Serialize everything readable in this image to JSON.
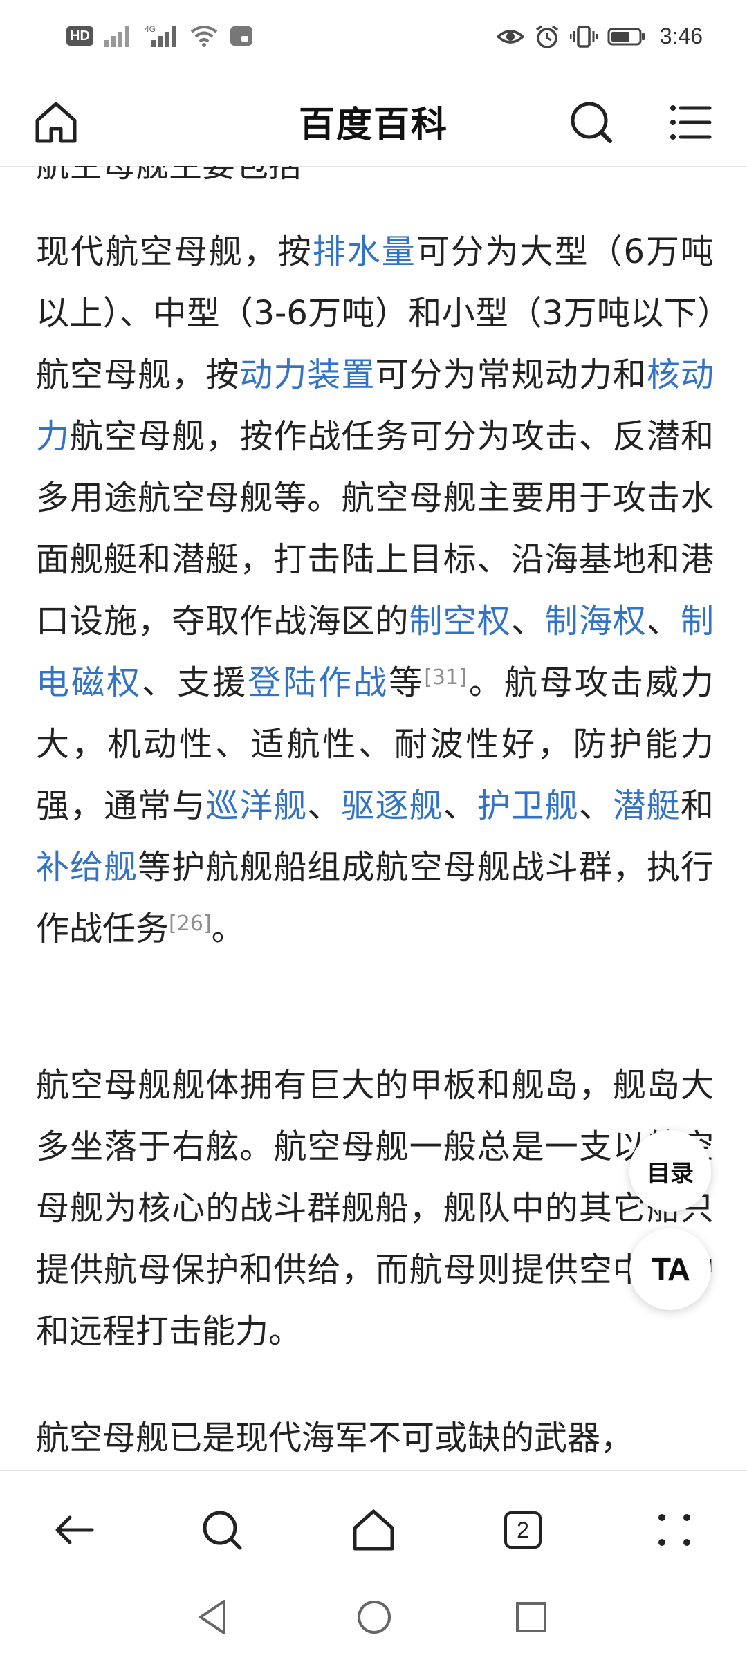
{
  "status_bar": {
    "hd_badge": "HD",
    "sim_label": "2",
    "net_label": "4G",
    "time": "3:46"
  },
  "header": {
    "title": "百度百科"
  },
  "content": {
    "partial_line": "航空母舰主要包括",
    "paragraphs": [
      {
        "segments": [
          {
            "text": "现代航空母舰，按",
            "link": false
          },
          {
            "text": "排水量",
            "link": true
          },
          {
            "text": "可分为大型（6万吨以上）、中型（3-6万吨）和小型（3万吨以下）航空母舰，按",
            "link": false
          },
          {
            "text": "动力装置",
            "link": true
          },
          {
            "text": "可分为常规动力和",
            "link": false
          },
          {
            "text": "核动力",
            "link": true
          },
          {
            "text": "航空母舰，按作战任务可分为攻击、反潜和多用途航空母舰等。航空母舰主要用于攻击水面舰艇和潜艇，打击陆上目标、沿海基地和港口设施，夺取作战海区的",
            "link": false
          },
          {
            "text": "制空权",
            "link": true
          },
          {
            "text": "、",
            "link": false
          },
          {
            "text": "制海权",
            "link": true
          },
          {
            "text": "、",
            "link": false
          },
          {
            "text": "制电磁权",
            "link": true
          },
          {
            "text": "、支援",
            "link": false
          },
          {
            "text": "登陆作战",
            "link": true
          },
          {
            "text": "等",
            "link": false
          },
          {
            "text": "[31]",
            "ref": true
          },
          {
            "text": "。航母攻击威力大，机动性、适航性、耐波性好，防护能力强，通常与",
            "link": false
          },
          {
            "text": "巡洋舰",
            "link": true
          },
          {
            "text": "、",
            "link": false
          },
          {
            "text": "驱逐舰",
            "link": true
          },
          {
            "text": "、",
            "link": false
          },
          {
            "text": "护卫舰",
            "link": true
          },
          {
            "text": "、",
            "link": false
          },
          {
            "text": "潜艇",
            "link": true
          },
          {
            "text": "和",
            "link": false
          },
          {
            "text": "补给舰",
            "link": true
          },
          {
            "text": "等护航舰船组成航空母舰战斗群，执行作战任务",
            "link": false
          },
          {
            "text": "[26]",
            "ref": true
          },
          {
            "text": "。",
            "link": false
          }
        ]
      },
      {
        "segments": [
          {
            "text": "航空母舰舰体拥有巨大的甲板和舰岛，舰岛大多坐落于右舷。航空母舰一般总是一支以航空母舰为核心的战斗群舰船，舰队中的其它船只提供航母保护和供给，而航母则提供空中掩护和远程打击能力。",
            "link": false
          }
        ]
      },
      {
        "segments": [
          {
            "text": "航空母舰已是现代海军不可或缺的武器，",
            "link": false
          }
        ]
      }
    ]
  },
  "floating": {
    "toc_label": "目录",
    "font_label": "TA"
  },
  "toolbar": {
    "tab_count": "2"
  },
  "colors": {
    "link": "#3273c6",
    "text": "#222222",
    "ref": "#8e8e8e"
  }
}
